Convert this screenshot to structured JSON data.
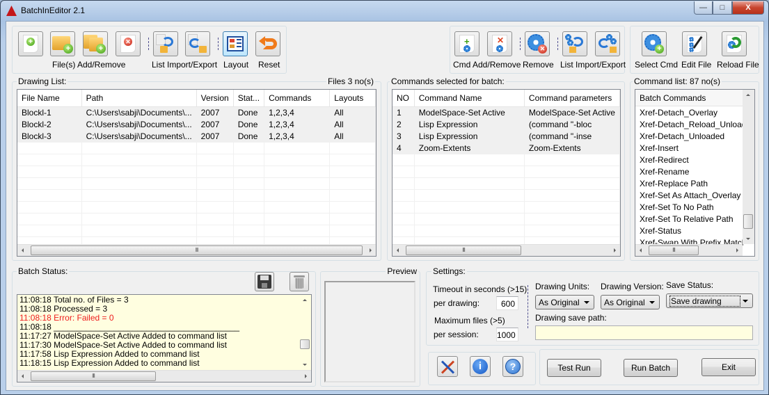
{
  "window": {
    "title": "BatchInEditor 2.1",
    "controls": {
      "minimize": "—",
      "maximize": "□",
      "close": "X"
    }
  },
  "toolbar_files": {
    "add_file_icon": "add-file-icon",
    "add_folder_icon": "add-folder-icon",
    "add_folders_icon": "add-subfolders-icon",
    "remove_file_icon": "remove-file-icon",
    "files_label": "File(s) Add/Remove",
    "list_import_icon": "list-import-icon",
    "list_export_icon": "list-export-icon",
    "list_label": "List Import/Export",
    "layout_label": "Layout",
    "reset_label": "Reset"
  },
  "toolbar_commands": {
    "cmd_add_remove_label": "Cmd Add/Remove",
    "remove_label": "Remove",
    "list_import_export_label": "List Import/Export"
  },
  "toolbar_cmdfile": {
    "select_cmd_label": "Select Cmd",
    "edit_file_label": "Edit File",
    "reload_file_label": "Reload File"
  },
  "drawing_list": {
    "label": "Drawing List:",
    "count": "Files 3 no(s)",
    "columns": [
      "File Name",
      "Path",
      "Version",
      "Stat...",
      "Commands",
      "Layouts"
    ],
    "rows": [
      [
        "Blockl-1",
        "C:\\Users\\sabji\\Documents\\...",
        "2007",
        "Done",
        "1,2,3,4",
        "All"
      ],
      [
        "Blockl-2",
        "C:\\Users\\sabji\\Documents\\...",
        "2007",
        "Done",
        "1,2,3,4",
        "All"
      ],
      [
        "Blockl-3",
        "C:\\Users\\sabji\\Documents\\...",
        "2007",
        "Done",
        "1,2,3,4",
        "All"
      ]
    ],
    "scroll_grip": "III"
  },
  "commands_selected": {
    "label": "Commands selected for batch:",
    "columns": [
      "NO",
      "Command Name",
      "Command parameters"
    ],
    "rows": [
      [
        "1",
        "ModelSpace-Set Active",
        "ModelSpace-Set Active"
      ],
      [
        "2",
        "Lisp Expression",
        "(command \"-bloc"
      ],
      [
        "3",
        "Lisp Expression",
        "(command \"-inse"
      ],
      [
        "4",
        "Zoom-Extents",
        "Zoom-Extents"
      ]
    ],
    "scroll_grip": "III"
  },
  "command_list": {
    "label": "Command list: 87 no(s)",
    "column": "Batch Commands",
    "items": [
      "Xref-Detach_Overlay",
      "Xref-Detach_Reload_Unload",
      "Xref-Detach_Unloaded",
      "Xref-Insert",
      "Xref-Redirect",
      "Xref-Rename",
      "Xref-Replace Path",
      "Xref-Set As Attach_Overlay",
      "Xref-Set To No Path",
      "Xref-Set To Relative Path",
      "Xref-Status",
      "Xref-Swap With Prefix Matching"
    ],
    "scroll_grip": "III"
  },
  "batch_status": {
    "label": "Batch Status:",
    "save_icon": "save-log-icon",
    "clear_icon": "trash-icon",
    "lines": [
      {
        "text": "11:08:18 Total no. of Files = 3",
        "error": false
      },
      {
        "text": "11:08:18 Processed = 3",
        "error": false
      },
      {
        "text": "11:08:18 Error: Failed = 0",
        "error": true
      },
      {
        "text": "11:08:18 ________________________________________",
        "error": false
      },
      {
        "text": "11:17:27  ModelSpace-Set Active Added to command list",
        "error": false
      },
      {
        "text": "11:17:30  ModelSpace-Set Active Added to command list",
        "error": false
      },
      {
        "text": "11:17:58  Lisp Expression Added to command list",
        "error": false
      },
      {
        "text": "11:18:15  Lisp Expression Added to command list",
        "error": false
      }
    ],
    "scroll_grip": "III"
  },
  "preview": {
    "label": "Preview"
  },
  "settings": {
    "label": "Settings:",
    "timeout_label": "Timeout in seconds (>15)",
    "per_drawing_label": "per drawing:",
    "per_drawing_value": "600",
    "max_files_label": "Maximum files (>5)",
    "per_session_label": "per session:",
    "per_session_value": "1000",
    "units_label": "Drawing Units:",
    "units_value": "As Original",
    "version_label": "Drawing Version:",
    "version_value": "As Original",
    "save_status_label": "Save Status:",
    "save_status_value": "Save drawing",
    "save_path_label": "Drawing save path:",
    "save_path_value": ""
  },
  "footer": {
    "tools_icon": "tools-icon",
    "info_icon": "info-icon",
    "help_icon": "help-icon",
    "info_glyph": "i",
    "help_glyph": "?",
    "test_run": "Test Run",
    "run_batch": "Run Batch",
    "exit": "Exit"
  }
}
